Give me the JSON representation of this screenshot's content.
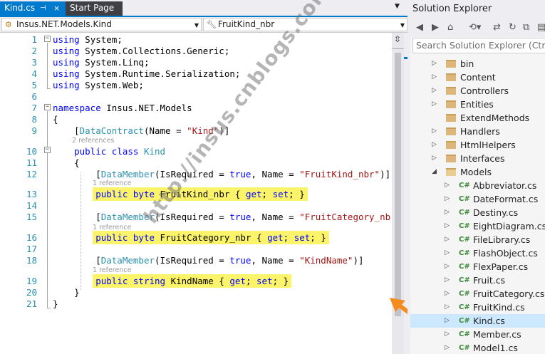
{
  "tabs": [
    {
      "label": "Kind.cs",
      "active": true,
      "pin": "⊣",
      "close": "×"
    },
    {
      "label": "Start Page",
      "active": false
    }
  ],
  "navbar": {
    "class_selector": "Insus.NET.Models.Kind",
    "member_selector": "FruitKind_nbr"
  },
  "code_lines": [
    {
      "n": "1",
      "html": "<span class=\"kw\">using</span> System;"
    },
    {
      "n": "2",
      "html": "<span class=\"kw\">using</span> System.Collections.Generic;"
    },
    {
      "n": "3",
      "html": "<span class=\"kw\">using</span> System.Linq;"
    },
    {
      "n": "4",
      "html": "<span class=\"kw\">using</span> System.Runtime.Serialization;"
    },
    {
      "n": "5",
      "html": "<span class=\"kw\">using</span> System.Web;"
    },
    {
      "n": "6",
      "html": ""
    },
    {
      "n": "7",
      "html": "<span class=\"kw\">namespace</span> Insus.NET.Models"
    },
    {
      "n": "8",
      "html": "{"
    },
    {
      "n": "9",
      "html": "    [<span class=\"ty\">DataContract</span>(Name = <span class=\"st\">\"Kind\"</span>)]"
    },
    {
      "n": "10",
      "html": "    <span class=\"kw\">public</span> <span class=\"kw\">class</span> <span class=\"ty\">Kind</span>"
    },
    {
      "n": "11",
      "html": "    {"
    },
    {
      "n": "12",
      "html": "        [<span class=\"ty\">DataMember</span>(IsRequired = <span class=\"kw\">true</span>, Name = <span class=\"st\">\"FruitKind_nbr\"</span>)]"
    },
    {
      "n": "13",
      "html": "        <span class=\"hl\"><span class=\"kw\">public</span> <span class=\"kw\">byte</span> FruitKind_nbr { <span class=\"kw\">get</span>; <span class=\"kw\">set</span>; }</span>"
    },
    {
      "n": "14",
      "html": ""
    },
    {
      "n": "15",
      "html": "        [<span class=\"ty\">DataMember</span>(IsRequired = <span class=\"kw\">true</span>, Name = <span class=\"st\">\"FruitCategory_nbr\"</span>)]"
    },
    {
      "n": "16",
      "html": "        <span class=\"hl\"><span class=\"kw\">public</span> <span class=\"kw\">byte</span> FruitCategory_nbr { <span class=\"kw\">get</span>; <span class=\"kw\">set</span>; }</span>"
    },
    {
      "n": "17",
      "html": ""
    },
    {
      "n": "18",
      "html": "        [<span class=\"ty\">DataMember</span>(IsRequired = <span class=\"kw\">true</span>, Name = <span class=\"st\">\"KindName\"</span>)]"
    },
    {
      "n": "19",
      "html": "        <span class=\"hl\"><span class=\"kw\">public</span> <span class=\"kw\">string</span> KindName { <span class=\"kw\">get</span>; <span class=\"kw\">set</span>; }</span>"
    },
    {
      "n": "20",
      "html": "    }"
    },
    {
      "n": "21",
      "html": "}"
    }
  ],
  "codelens": {
    "class_refs": "2 references",
    "prop1_refs": "1 reference",
    "prop2_refs": "1 reference",
    "prop3_refs": "1 reference"
  },
  "watermark": "http://insus.cnblogs.com",
  "solution_explorer": {
    "title": "Solution Explorer",
    "search_placeholder": "Search Solution Explorer (Ctrl+;)",
    "items": [
      {
        "label": "bin",
        "kind": "folder",
        "level": 1,
        "expander": "▷"
      },
      {
        "label": "Content",
        "kind": "folder",
        "level": 1,
        "expander": "▷"
      },
      {
        "label": "Controllers",
        "kind": "folder",
        "level": 1,
        "expander": "▷"
      },
      {
        "label": "Entities",
        "kind": "folder",
        "level": 1,
        "expander": "▷"
      },
      {
        "label": "ExtendMethods",
        "kind": "folder",
        "level": 1,
        "expander": ""
      },
      {
        "label": "Handlers",
        "kind": "folder",
        "level": 1,
        "expander": "▷"
      },
      {
        "label": "HtmlHelpers",
        "kind": "folder",
        "level": 1,
        "expander": "▷"
      },
      {
        "label": "Interfaces",
        "kind": "folder",
        "level": 1,
        "expander": "▷"
      },
      {
        "label": "Models",
        "kind": "folder-open",
        "level": 1,
        "expander": "◢"
      },
      {
        "label": "Abbreviator.cs",
        "kind": "cs",
        "level": 2,
        "expander": "▷"
      },
      {
        "label": "DateFormat.cs",
        "kind": "cs",
        "level": 2,
        "expander": "▷"
      },
      {
        "label": "Destiny.cs",
        "kind": "cs",
        "level": 2,
        "expander": "▷"
      },
      {
        "label": "EightDiagram.cs",
        "kind": "cs",
        "level": 2,
        "expander": "▷"
      },
      {
        "label": "FileLibrary.cs",
        "kind": "cs",
        "level": 2,
        "expander": "▷"
      },
      {
        "label": "FlashObject.cs",
        "kind": "cs",
        "level": 2,
        "expander": "▷"
      },
      {
        "label": "FlexPaper.cs",
        "kind": "cs",
        "level": 2,
        "expander": "▷"
      },
      {
        "label": "Fruit.cs",
        "kind": "cs",
        "level": 2,
        "expander": "▷"
      },
      {
        "label": "FruitCategory.cs",
        "kind": "cs",
        "level": 2,
        "expander": "▷"
      },
      {
        "label": "FruitKind.cs",
        "kind": "cs",
        "level": 2,
        "expander": "▷"
      },
      {
        "label": "Kind.cs",
        "kind": "cs",
        "level": 2,
        "expander": "▷",
        "selected": true
      },
      {
        "label": "Member.cs",
        "kind": "cs",
        "level": 2,
        "expander": "▷"
      },
      {
        "label": "Model1.cs",
        "kind": "cs",
        "level": 2,
        "expander": "▷"
      }
    ]
  },
  "colors": {
    "accent": "#007acc",
    "highlight": "#fbf36a",
    "selection": "#cce8ff",
    "arrow": "#f28c1e"
  }
}
